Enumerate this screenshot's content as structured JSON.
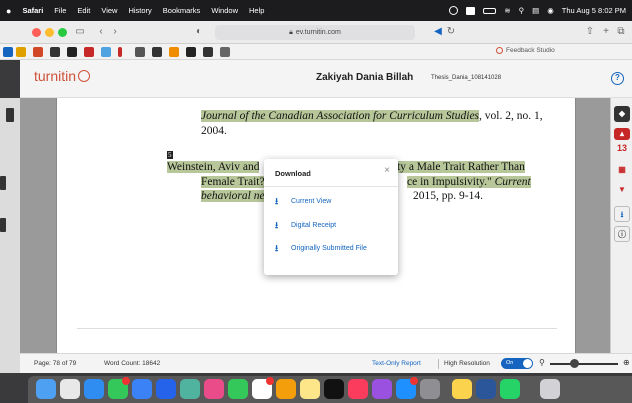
{
  "menubar": {
    "apple": "",
    "items": [
      "Safari",
      "File",
      "Edit",
      "View",
      "History",
      "Bookmarks",
      "Window",
      "Help"
    ],
    "datetime": "Thu Aug 5 8:02 PM"
  },
  "browser": {
    "url": "ev.turnitin.com",
    "tab_label": "Feedback Studio"
  },
  "header": {
    "logo": "turnitin",
    "student_name": "Zakiyah Dania Billah",
    "paper_title": "Thesis_Dania_108141028"
  },
  "document": {
    "line1_journal": "Journal of the Canadian Association for Curriculum Studies",
    "line1_rest": ", vol. 2, no. 1,",
    "line2": "2004.",
    "marker": "5",
    "line3_left": "Weinstein, Aviv and",
    "line3_right": "ty a Male Trait Rather Than",
    "line4_left": "Female Trait?",
    "line4_right_plain": "ce in Impulsivity.\"",
    "line4_right_italic": "Current",
    "line5_left": "behavioral neu",
    "line5_right": "2015, pp. 9-14."
  },
  "modal": {
    "title": "Download",
    "close": "×",
    "options": [
      "Current View",
      "Digital Receipt",
      "Originally Submitted File"
    ]
  },
  "right_tools": {
    "match_count": "13"
  },
  "status": {
    "page": "Page: 78 of 79",
    "word_count": "Word Count: 18642",
    "text_only": "Text-Only Report",
    "high_res": "High Resolution",
    "toggle": "On"
  },
  "colors": {
    "accent": "#1565c0",
    "brand": "#d0513a",
    "highlight": "#b7c79a",
    "match_red": "#c62828"
  }
}
